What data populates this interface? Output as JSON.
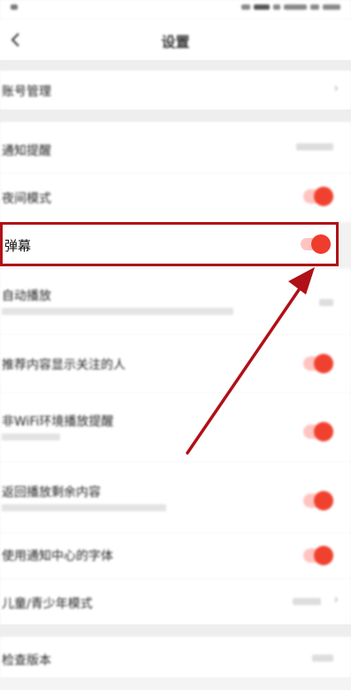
{
  "header": {
    "title": "设置"
  },
  "settings_rows": [
    {
      "label": "账号管理",
      "type": "chevron"
    },
    {
      "label": "通知提醒",
      "type": "value"
    },
    {
      "label": "夜间模式",
      "type": "toggle",
      "on": true
    },
    {
      "label": "弹幕",
      "type": "toggle",
      "on": true,
      "highlighted": true
    },
    {
      "label": "自动播放",
      "type": "value"
    },
    {
      "label": "推荐内容显示关注的人",
      "type": "toggle",
      "on": true
    },
    {
      "label": "非WiFi环境播放提醒",
      "type": "toggle",
      "on": true
    },
    {
      "label": "返回播放剩余内容",
      "type": "toggle",
      "on": true
    },
    {
      "label": "使用通知中心的字体",
      "type": "toggle",
      "on": true
    },
    {
      "label": "儿童/青少年模式",
      "type": "value"
    },
    {
      "label": "检查版本",
      "type": "value"
    }
  ],
  "colors": {
    "highlight_border": "#b01018",
    "toggle_on": "#ef3c2d",
    "arrow": "#b01018"
  }
}
